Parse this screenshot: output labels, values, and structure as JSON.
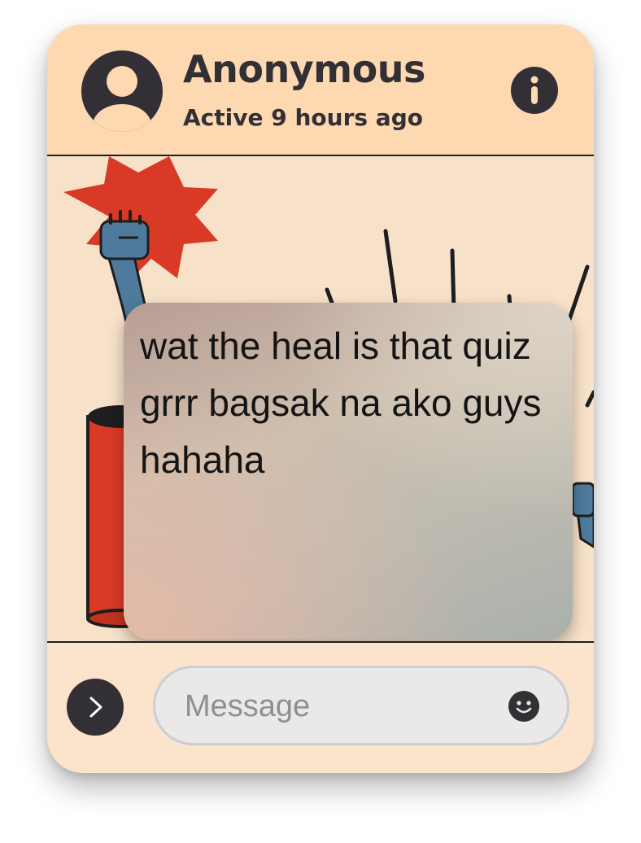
{
  "contact": {
    "name": "Anonymous",
    "status": "Active 9 hours ago",
    "avatar_icon": "user-icon",
    "info_icon": "info-icon"
  },
  "message": {
    "text": "wat the heal is that quiz grrr bagsak na ako guys hahaha",
    "background": "comic illustration with raised fists and red starburst"
  },
  "composer": {
    "placeholder": "Message",
    "value": "",
    "send_icon": "chevron-right-icon",
    "emoji_icon": "smiley-icon"
  },
  "colors": {
    "header_bg": "#fdd8b0",
    "card_bg": "#fbe3cc",
    "dark": "#333035",
    "accent_red": "#d93a26",
    "accent_blue": "#4e7a9c"
  }
}
